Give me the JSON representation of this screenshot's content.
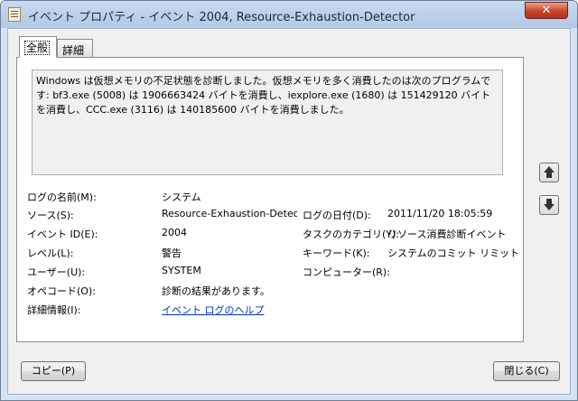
{
  "window": {
    "title": "イベント プロパティ - イベント 2004, Resource-Exhaustion-Detector",
    "close_glyph": "✕"
  },
  "tabs": [
    {
      "label": "全般"
    },
    {
      "label": "詳細"
    }
  ],
  "message": "Windows は仮想メモリの不足状態を診断しました。仮想メモリを多く消費したのは次のプログラムです: bf3.exe (5008) は 1906663424 バイトを消費し、iexplore.exe (1680) は 151429120 バイトを消費し、CCC.exe (3116) は 140185600 バイトを消費しました。",
  "fields": {
    "log_name_label": "ログの名前(M):",
    "log_name_value": "システム",
    "source_label": "ソース(S):",
    "source_value": "Resource-Exhaustion-Detect",
    "logged_label": "ログの日付(D):",
    "logged_value": "2011/11/20 18:05:59",
    "event_id_label": "イベント ID(E):",
    "event_id_value": "2004",
    "task_category_label": "タスクのカテゴリ(Y):",
    "task_category_value": "リソース消費診断イベント",
    "level_label": "レベル(L):",
    "level_value": "警告",
    "keywords_label": "キーワード(K):",
    "keywords_value": "システムのコミット リミット (仮",
    "user_label": "ユーザー(U):",
    "user_value": "SYSTEM",
    "computer_label": "コンピューター(R):",
    "computer_value": "",
    "opcode_label": "オペコード(O):",
    "opcode_value": "診断の結果があります。",
    "more_info_label": "詳細情報(I):",
    "more_info_link": "イベント ログのヘルプ"
  },
  "buttons": {
    "copy": "コピー(P)",
    "close": "閉じる(C)"
  },
  "icons": {
    "app": "event-viewer-icon",
    "close": "close-icon",
    "previous": "arrow-up-icon",
    "next": "arrow-down-icon"
  }
}
